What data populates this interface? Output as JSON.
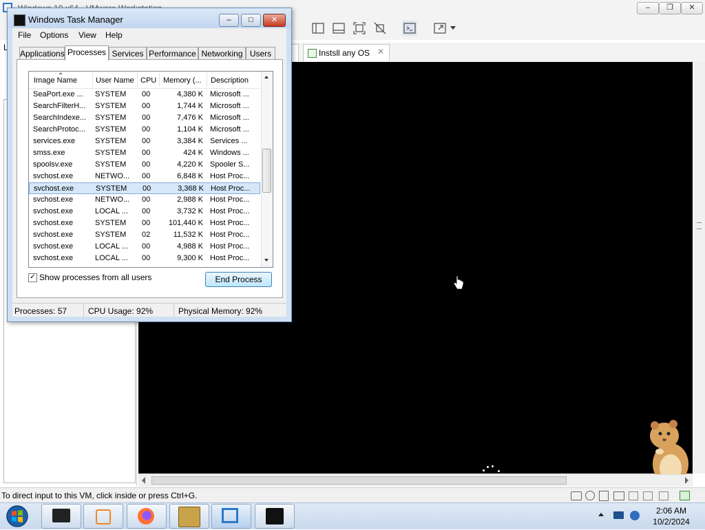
{
  "vm": {
    "title": "Windows 10 x64 - VMware Workstation",
    "sidebar_label": "L",
    "tab_label": "Instsll any OS",
    "status_text": "To direct input to this VM, click inside or press Ctrl+G."
  },
  "task_manager": {
    "title": "Windows Task Manager",
    "menu": [
      "File",
      "Options",
      "View",
      "Help"
    ],
    "tabs": [
      "Applications",
      "Processes",
      "Services",
      "Performance",
      "Networking",
      "Users"
    ],
    "active_tab": "Processes",
    "columns": [
      "Image Name",
      "User Name",
      "CPU",
      "Memory (...",
      "Description"
    ],
    "processes": [
      {
        "image": "SeaPort.exe ...",
        "user": "SYSTEM",
        "cpu": "00",
        "memory": "4,380 K",
        "description": "Microsoft ..."
      },
      {
        "image": "SearchFilterH...",
        "user": "SYSTEM",
        "cpu": "00",
        "memory": "1,744 K",
        "description": "Microsoft ..."
      },
      {
        "image": "SearchIndexe...",
        "user": "SYSTEM",
        "cpu": "00",
        "memory": "7,476 K",
        "description": "Microsoft ..."
      },
      {
        "image": "SearchProtoc...",
        "user": "SYSTEM",
        "cpu": "00",
        "memory": "1,104 K",
        "description": "Microsoft ..."
      },
      {
        "image": "services.exe",
        "user": "SYSTEM",
        "cpu": "00",
        "memory": "3,384 K",
        "description": "Services ..."
      },
      {
        "image": "smss.exe",
        "user": "SYSTEM",
        "cpu": "00",
        "memory": "424 K",
        "description": "Windows ..."
      },
      {
        "image": "spoolsv.exe",
        "user": "SYSTEM",
        "cpu": "00",
        "memory": "4,220 K",
        "description": "Spooler S..."
      },
      {
        "image": "svchost.exe",
        "user": "NETWO...",
        "cpu": "00",
        "memory": "6,848 K",
        "description": "Host Proc..."
      },
      {
        "image": "svchost.exe",
        "user": "SYSTEM",
        "cpu": "00",
        "memory": "3,368 K",
        "description": "Host Proc...",
        "selected": true
      },
      {
        "image": "svchost.exe",
        "user": "NETWO...",
        "cpu": "00",
        "memory": "2,988 K",
        "description": "Host Proc..."
      },
      {
        "image": "svchost.exe",
        "user": "LOCAL ...",
        "cpu": "00",
        "memory": "3,732 K",
        "description": "Host Proc..."
      },
      {
        "image": "svchost.exe",
        "user": "SYSTEM",
        "cpu": "00",
        "memory": "101,440 K",
        "description": "Host Proc..."
      },
      {
        "image": "svchost.exe",
        "user": "SYSTEM",
        "cpu": "02",
        "memory": "11,532 K",
        "description": "Host Proc..."
      },
      {
        "image": "svchost.exe",
        "user": "LOCAL ...",
        "cpu": "00",
        "memory": "4,988 K",
        "description": "Host Proc..."
      },
      {
        "image": "svchost.exe",
        "user": "LOCAL ...",
        "cpu": "00",
        "memory": "9,300 K",
        "description": "Host Proc..."
      }
    ],
    "show_all_label": "Show processes from all users",
    "show_all_checked": true,
    "end_process_label": "End Process",
    "status": {
      "processes": "Processes: 57",
      "cpu": "CPU Usage: 92%",
      "memory": "Physical Memory: 92%"
    }
  },
  "taskbar": {
    "time": "2:06 AM",
    "date": "10/2/2024",
    "apps": [
      "terminal-icon",
      "media-player-icon",
      "firefox-icon",
      "virtualbox-icon",
      "vmware-icon",
      "vm-console-icon"
    ]
  },
  "colors": {
    "selection": "#d6e7f9",
    "console": "#000000",
    "taskbar": "#c9d9ec"
  }
}
